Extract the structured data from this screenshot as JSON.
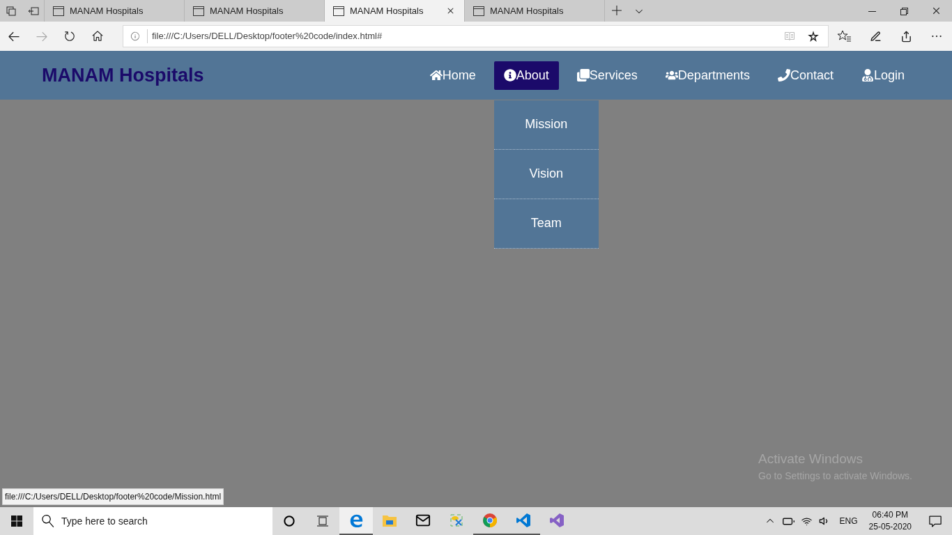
{
  "browser": {
    "tabs": [
      {
        "title": "MANAM Hospitals",
        "selected": false
      },
      {
        "title": "MANAM Hospitals",
        "selected": false
      },
      {
        "title": "MANAM Hospitals",
        "selected": true
      },
      {
        "title": "MANAM Hospitals",
        "selected": false
      }
    ],
    "address": "file:///C:/Users/DELL/Desktop/footer%20code/index.html#",
    "status_url": "file:///C:/Users/DELL/Desktop/footer%20code/Mission.html"
  },
  "page": {
    "brand": "MANAM Hospitals",
    "nav": [
      {
        "label": "Home",
        "kind": "home",
        "selected": false
      },
      {
        "label": "About",
        "kind": "info",
        "selected": true,
        "menu": [
          "Mission",
          "Vision",
          "Team"
        ]
      },
      {
        "label": "Services",
        "kind": "services",
        "selected": false
      },
      {
        "label": "Departments",
        "kind": "departments",
        "selected": false
      },
      {
        "label": "Contact",
        "kind": "phone",
        "selected": false
      },
      {
        "label": "Login",
        "kind": "login",
        "selected": false
      }
    ]
  },
  "activation": {
    "title": "Activate Windows",
    "text": "Go to Settings to activate Windows."
  },
  "taskbar": {
    "search_placeholder": "Type here to search",
    "apps": [
      {
        "kind": "edge",
        "selected": true,
        "running": true
      },
      {
        "kind": "explorer",
        "selected": false,
        "running": false
      },
      {
        "kind": "mail",
        "selected": false,
        "running": false
      },
      {
        "kind": "tool",
        "selected": false,
        "running": false
      },
      {
        "kind": "chrome",
        "selected": false,
        "running": true
      },
      {
        "kind": "vscode",
        "selected": false,
        "running": true
      },
      {
        "kind": "vs",
        "selected": false,
        "running": false
      }
    ],
    "language": "ENG",
    "time": "06:40 PM",
    "date": "25-05-2020"
  }
}
